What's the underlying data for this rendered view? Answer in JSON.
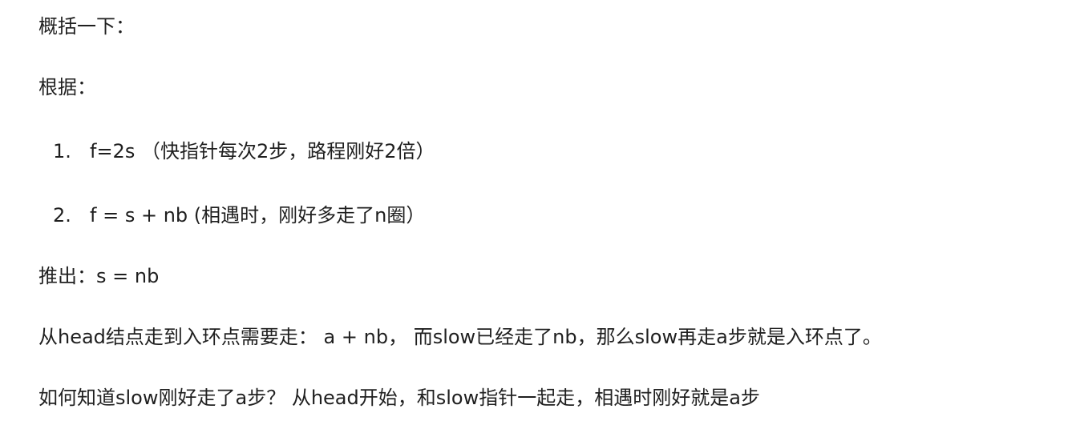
{
  "paragraphs": {
    "summary_heading": "概括一下：",
    "basis_heading": "根据：",
    "derive": "推出：s = nb",
    "path": "从head结点走到入环点需要走： a + nb， 而slow已经走了nb，那么slow再走a步就是入环点了。",
    "how": "如何知道slow刚好走了a步？ 从head开始，和slow指针一起走，相遇时刚好就是a步"
  },
  "list": [
    {
      "marker": "1.",
      "text": "f=2s （快指针每次2步，路程刚好2倍）"
    },
    {
      "marker": "2.",
      "text": "f = s + nb (相遇时，刚好多走了n圈）"
    }
  ]
}
